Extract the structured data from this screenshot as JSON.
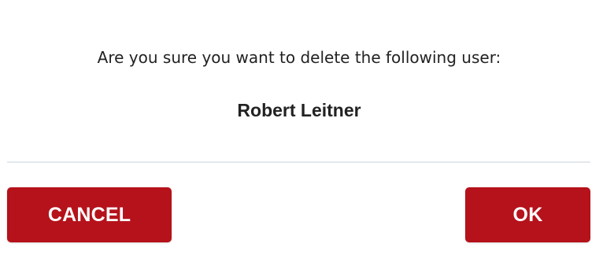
{
  "dialog": {
    "message": "Are you sure you want to delete the following user:",
    "user_name": "Robert Leitner",
    "cancel_label": "CANCEL",
    "ok_label": "OK"
  },
  "colors": {
    "button_bg": "#b5121b",
    "button_text": "#ffffff",
    "divider": "#e4e9ee",
    "text": "#222222"
  }
}
